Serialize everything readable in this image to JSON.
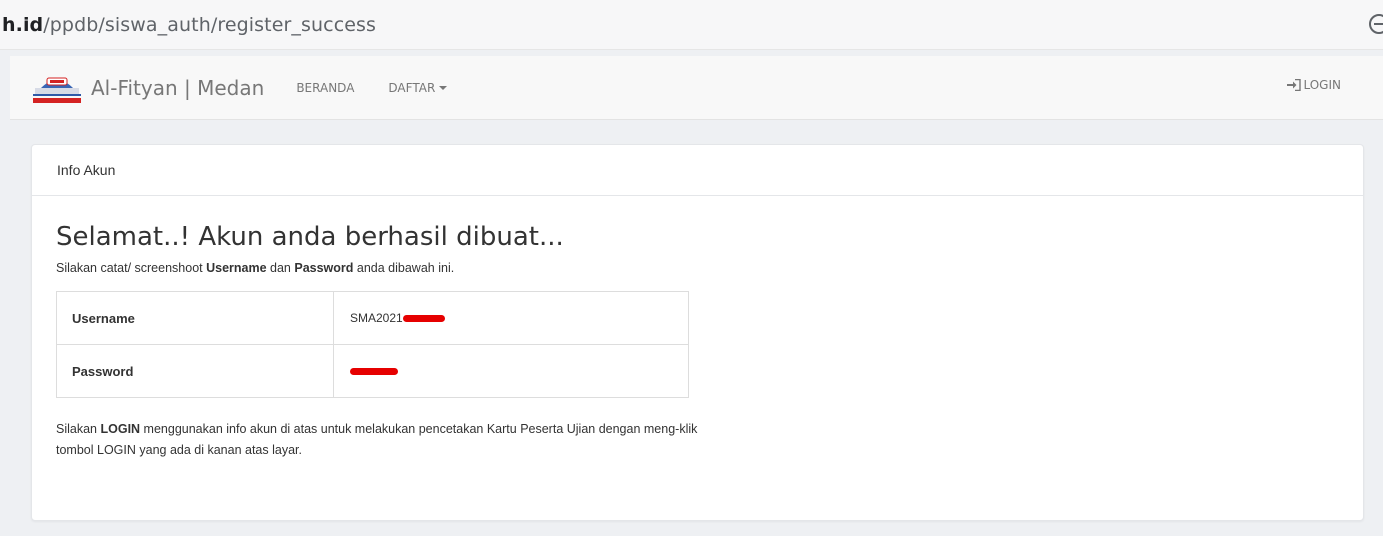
{
  "browser": {
    "url_host": "h.id",
    "url_path": "/ppdb/siswa_auth/register_success"
  },
  "navbar": {
    "brand": "Al-Fityan | Medan",
    "links": [
      "BERANDA",
      "DAFTAR"
    ],
    "login_label": "LOGIN"
  },
  "panel": {
    "heading": "Info Akun",
    "title": "Selamat..! Akun anda berhasil dibuat...",
    "subtitle_pre": "Silakan catat/ screenshoot ",
    "subtitle_b1": "Username",
    "subtitle_mid": " dan ",
    "subtitle_b2": "Password",
    "subtitle_post": " anda dibawah ini.",
    "rows": [
      {
        "label": "Username",
        "value": "SMA2021"
      },
      {
        "label": "Password",
        "value": ""
      }
    ],
    "footer_pre": "Silakan ",
    "footer_b": "LOGIN",
    "footer_post": " menggunakan info akun di atas untuk melakukan pencetakan Kartu Peserta Ujian dengan meng-klik tombol LOGIN yang ada di kanan atas layar."
  },
  "colors": {
    "redaction": "#e60000",
    "navbar_bg": "#f8f8f8",
    "page_bg": "#eef0f3"
  }
}
